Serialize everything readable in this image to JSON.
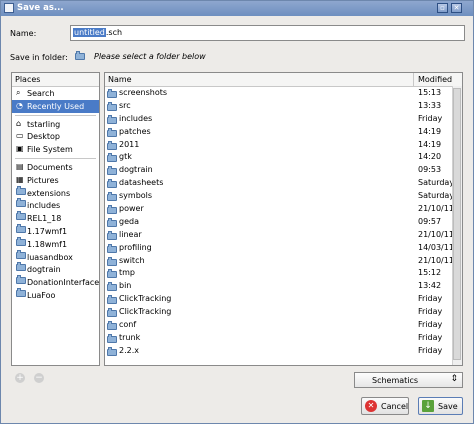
{
  "window": {
    "title": "Save as..."
  },
  "form": {
    "name_label": "Name:",
    "name_selected": "untitled",
    "name_rest": ".sch",
    "folder_label": "Save in folder:",
    "folder_message": "Please select a folder below"
  },
  "places": {
    "header": "Places",
    "items": [
      {
        "label": "Search",
        "icon": "search-icon"
      },
      {
        "label": "Recently Used",
        "icon": "recent-icon"
      },
      {
        "label": "tstarling",
        "icon": "home-icon"
      },
      {
        "label": "Desktop",
        "icon": "desktop-icon"
      },
      {
        "label": "File System",
        "icon": "drive-icon"
      },
      {
        "label": "Documents",
        "icon": "documents-icon"
      },
      {
        "label": "Pictures",
        "icon": "pictures-icon"
      },
      {
        "label": "extensions",
        "icon": "folder-icon"
      },
      {
        "label": "includes",
        "icon": "folder-icon"
      },
      {
        "label": "REL1_18",
        "icon": "folder-icon"
      },
      {
        "label": "1.17wmf1",
        "icon": "folder-icon"
      },
      {
        "label": "1.18wmf1",
        "icon": "folder-icon"
      },
      {
        "label": "luasandbox",
        "icon": "folder-icon"
      },
      {
        "label": "dogtrain",
        "icon": "folder-icon"
      },
      {
        "label": "DonationInterface",
        "icon": "folder-icon"
      },
      {
        "label": "LuaFoo",
        "icon": "folder-icon"
      }
    ]
  },
  "files": {
    "col_name": "Name",
    "col_modified": "Modified",
    "rows": [
      {
        "name": "screenshots",
        "modified": "15:13"
      },
      {
        "name": "src",
        "modified": "13:33"
      },
      {
        "name": "includes",
        "modified": "Friday"
      },
      {
        "name": "patches",
        "modified": "14:19"
      },
      {
        "name": "2011",
        "modified": "14:19"
      },
      {
        "name": "gtk",
        "modified": "14:20"
      },
      {
        "name": "dogtrain",
        "modified": "09:53"
      },
      {
        "name": "datasheets",
        "modified": "Saturday"
      },
      {
        "name": "symbols",
        "modified": "Saturday"
      },
      {
        "name": "power",
        "modified": "21/10/11"
      },
      {
        "name": "geda",
        "modified": "09:57"
      },
      {
        "name": "linear",
        "modified": "21/10/11"
      },
      {
        "name": "profiling",
        "modified": "14/03/11"
      },
      {
        "name": "switch",
        "modified": "21/10/11"
      },
      {
        "name": "tmp",
        "modified": "15:12"
      },
      {
        "name": "bin",
        "modified": "13:42"
      },
      {
        "name": "ClickTracking",
        "modified": "Friday"
      },
      {
        "name": "ClickTracking",
        "modified": "Friday"
      },
      {
        "name": "conf",
        "modified": "Friday"
      },
      {
        "name": "trunk",
        "modified": "Friday"
      },
      {
        "name": "2.2.x",
        "modified": "Friday"
      }
    ]
  },
  "filter": {
    "selected": "Schematics"
  },
  "buttons": {
    "cancel": "Cancel",
    "save": "Save"
  },
  "colors": {
    "selection": "#4a7bc7",
    "titlebar": "#7a98c7"
  }
}
